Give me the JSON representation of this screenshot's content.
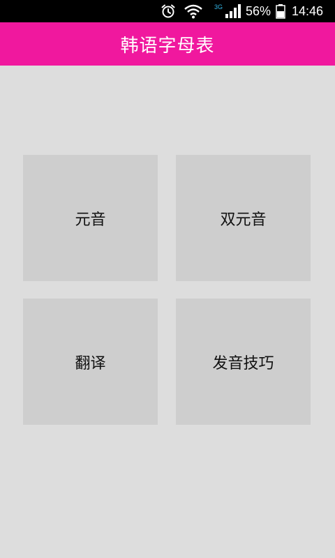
{
  "status_bar": {
    "icons": [
      "alarm-icon",
      "wifi-icon",
      "signal-3g-icon",
      "battery-icon"
    ],
    "network_type": "3G",
    "battery_percent": "56%",
    "battery_level": 0.56,
    "time": "14:46"
  },
  "app": {
    "title": "韩语字母表",
    "accent_color": "#f0189e"
  },
  "menu": {
    "items": [
      {
        "label": "元音"
      },
      {
        "label": "双元音"
      },
      {
        "label": "翻译"
      },
      {
        "label": "发音技巧"
      }
    ]
  }
}
